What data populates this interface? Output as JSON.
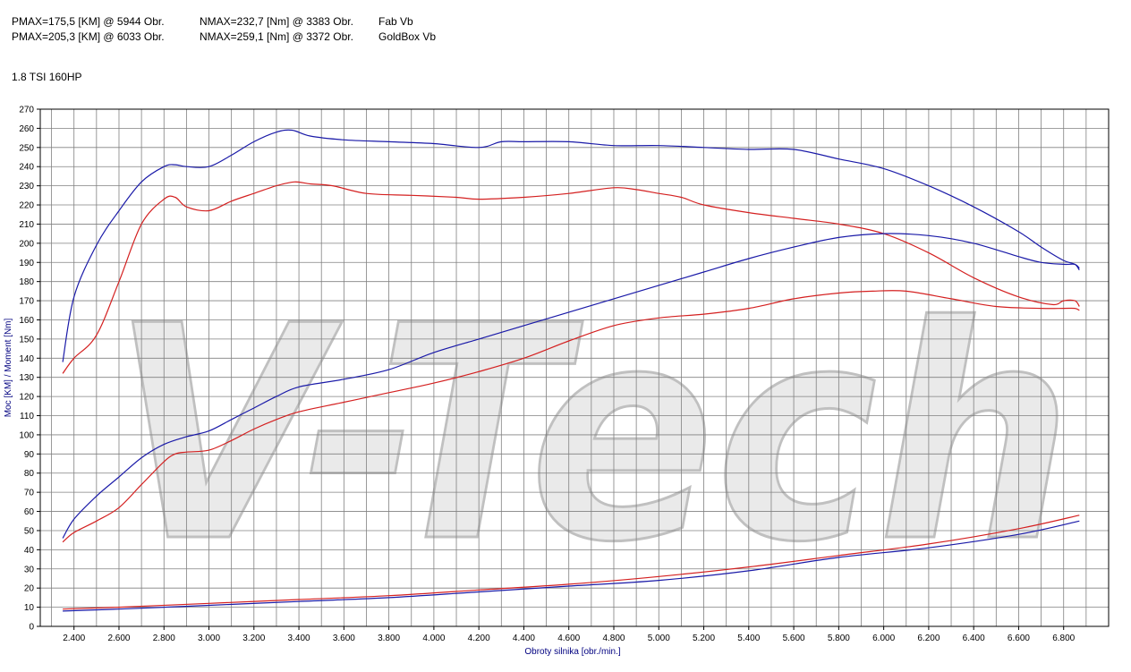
{
  "header": {
    "line1": {
      "pmax": "PMAX=175,5 [KM] @ 5944 Obr.",
      "nmax": "NMAX=232,7 [Nm] @ 3383 Obr.",
      "name": "Fab Vb"
    },
    "line2": {
      "pmax": "PMAX=205,3 [KM] @ 6033 Obr.",
      "nmax": "NMAX=259,1 [Nm] @ 3372 Obr.",
      "name": "GoldBox Vb"
    },
    "engine": "1.8 TSI 160HP"
  },
  "watermark": "V-Tech",
  "colors": {
    "fab": "#d42020",
    "goldbox": "#1a1aa8",
    "grid": "#808080",
    "axis_title": "#000080",
    "watermark": "#d9d9d9"
  },
  "chart_data": {
    "type": "line",
    "xlabel": "Obroty silnika [obr./min.]",
    "ylabel": "Moc [KM] / Moment [Nm]",
    "xlim": [
      2250,
      7000
    ],
    "ylim": [
      0,
      270
    ],
    "x_ticks": [
      "2.400",
      "2.600",
      "2.800",
      "3.000",
      "3.200",
      "3.400",
      "3.600",
      "3.800",
      "4.000",
      "4.200",
      "4.400",
      "4.600",
      "4.800",
      "5.000",
      "5.200",
      "5.400",
      "5.600",
      "5.800",
      "6.000",
      "6.200",
      "6.400",
      "6.600",
      "6.800"
    ],
    "y_ticks": [
      "0",
      "10",
      "20",
      "30",
      "40",
      "50",
      "60",
      "70",
      "80",
      "90",
      "100",
      "110",
      "120",
      "130",
      "140",
      "150",
      "160",
      "170",
      "180",
      "190",
      "200",
      "210",
      "220",
      "230",
      "240",
      "250",
      "260",
      "270"
    ],
    "grid": true,
    "series": [
      {
        "name": "GoldBox Vb",
        "measure": "torque",
        "color": "#1a1aa8",
        "x": [
          2350,
          2400,
          2500,
          2600,
          2700,
          2800,
          2850,
          2900,
          3000,
          3100,
          3200,
          3300,
          3370,
          3450,
          3600,
          3800,
          4000,
          4200,
          4300,
          4400,
          4600,
          4800,
          5000,
          5200,
          5400,
          5600,
          5800,
          6000,
          6200,
          6400,
          6600,
          6700,
          6800,
          6850,
          6870
        ],
        "y": [
          138,
          172,
          199,
          217,
          232,
          240,
          241,
          240,
          240,
          246,
          253,
          258,
          259,
          256,
          254,
          253,
          252,
          250,
          253,
          253,
          253,
          251,
          251,
          250,
          249,
          249,
          244,
          239,
          230,
          219,
          206,
          198,
          191,
          189,
          186
        ]
      },
      {
        "name": "Fab Vb",
        "measure": "torque",
        "color": "#d42020",
        "x": [
          2350,
          2400,
          2500,
          2600,
          2700,
          2800,
          2850,
          2900,
          3000,
          3100,
          3200,
          3300,
          3380,
          3450,
          3550,
          3700,
          3900,
          4100,
          4200,
          4400,
          4600,
          4800,
          4900,
          5000,
          5100,
          5200,
          5400,
          5600,
          5800,
          6000,
          6200,
          6400,
          6600,
          6750,
          6800,
          6850,
          6870
        ],
        "y": [
          132,
          140,
          152,
          180,
          210,
          223,
          224,
          219,
          217,
          222,
          226,
          230,
          232,
          231,
          230,
          226,
          225,
          224,
          223,
          224,
          226,
          229,
          228,
          226,
          224,
          220,
          216,
          213,
          210,
          205,
          195,
          182,
          172,
          168,
          170,
          170,
          167
        ]
      },
      {
        "name": "GoldBox Vb",
        "measure": "power",
        "color": "#1a1aa8",
        "x": [
          2350,
          2400,
          2500,
          2600,
          2700,
          2800,
          2900,
          3000,
          3100,
          3200,
          3300,
          3400,
          3600,
          3800,
          4000,
          4200,
          4400,
          4600,
          4800,
          5000,
          5200,
          5400,
          5600,
          5800,
          6000,
          6200,
          6400,
          6600,
          6700,
          6800,
          6850,
          6870
        ],
        "y": [
          46,
          56,
          68,
          78,
          88,
          95,
          99,
          102,
          108,
          114,
          120,
          125,
          129,
          134,
          143,
          150,
          157,
          164,
          171,
          178,
          185,
          192,
          198,
          203,
          205,
          204,
          200,
          193,
          190,
          189,
          189,
          187
        ]
      },
      {
        "name": "Fab Vb",
        "measure": "power",
        "color": "#d42020",
        "x": [
          2350,
          2400,
          2500,
          2600,
          2700,
          2800,
          2850,
          2900,
          3000,
          3100,
          3200,
          3300,
          3400,
          3600,
          3800,
          4000,
          4200,
          4400,
          4600,
          4800,
          5000,
          5200,
          5400,
          5600,
          5800,
          5950,
          6100,
          6300,
          6500,
          6700,
          6800,
          6850,
          6870
        ],
        "y": [
          44,
          49,
          55,
          62,
          74,
          86,
          90,
          91,
          92,
          97,
          103,
          108,
          112,
          117,
          122,
          127,
          133,
          140,
          149,
          157,
          161,
          163,
          166,
          171,
          174,
          175,
          175,
          171,
          167,
          166,
          166,
          166,
          165
        ]
      },
      {
        "name": "GoldBox Vb",
        "measure": "loss",
        "color": "#1a1aa8",
        "x": [
          2350,
          2600,
          3000,
          3400,
          3800,
          4200,
          4600,
          5000,
          5400,
          5800,
          6200,
          6600,
          6870
        ],
        "y": [
          8,
          9,
          11,
          13,
          15,
          18,
          21,
          24,
          29,
          36,
          41,
          48,
          55
        ]
      },
      {
        "name": "Fab Vb",
        "measure": "loss",
        "color": "#d42020",
        "x": [
          2350,
          2600,
          3000,
          3400,
          3800,
          4200,
          4600,
          5000,
          5400,
          5800,
          6200,
          6600,
          6870
        ],
        "y": [
          9,
          10,
          12,
          14,
          16,
          19,
          22,
          26,
          31,
          37,
          43,
          51,
          58
        ]
      }
    ]
  }
}
